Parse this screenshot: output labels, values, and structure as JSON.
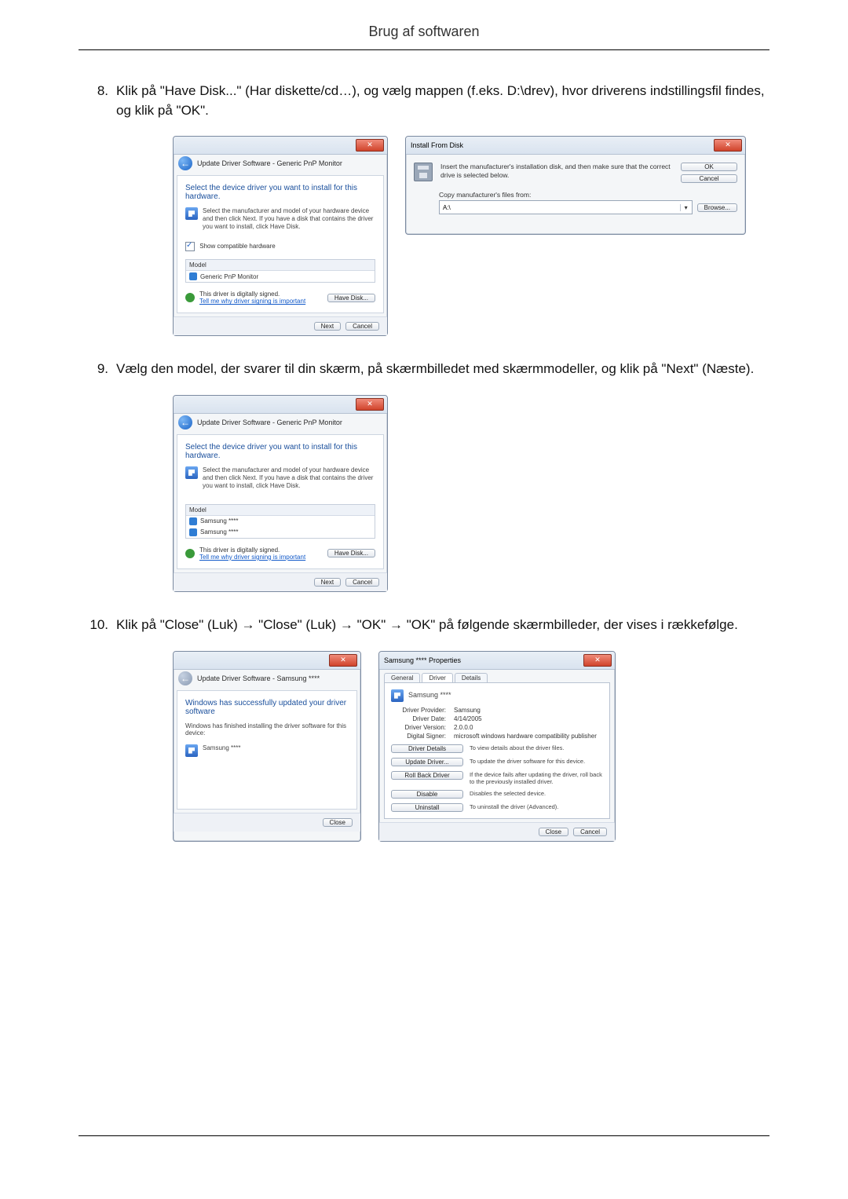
{
  "header": {
    "title": "Brug af softwaren"
  },
  "steps": {
    "s8": {
      "num": "8.",
      "text": "Klik på \"Have Disk...\" (Har diskette/cd…), og vælg mappen (f.eks. D:\\drev), hvor driverens indstillingsfil findes, og klik på \"OK\"."
    },
    "s9": {
      "num": "9.",
      "text": "Vælg den model, der svarer til din skærm, på skærmbilledet med skærmmodeller, og klik på \"Next\" (Næste)."
    },
    "s10": {
      "num": "10.",
      "text": "Klik på \"Close\" (Luk) → \"Close\" (Luk) → \"OK\" → \"OK\" på følgende skærmbilleder, der vises i rækkefølge."
    }
  },
  "shot_a": {
    "breadcrumb": "Update Driver Software - Generic PnP Monitor",
    "heading": "Select the device driver you want to install for this hardware.",
    "subtext": "Select the manufacturer and model of your hardware device and then click Next. If you have a disk that contains the driver you want to install, click Have Disk.",
    "check_label": "Show compatible hardware",
    "list_header": "Model",
    "list_item": "Generic PnP Monitor",
    "signed_text": "This driver is digitally signed.",
    "signed_link": "Tell me why driver signing is important",
    "have_disk": "Have Disk...",
    "next": "Next",
    "cancel": "Cancel"
  },
  "shot_b": {
    "title": "Install From Disk",
    "msg": "Insert the manufacturer's installation disk, and then make sure that the correct drive is selected below.",
    "ok": "OK",
    "cancel": "Cancel",
    "copy_label": "Copy manufacturer's files from:",
    "combo_value": "A:\\",
    "browse": "Browse..."
  },
  "shot_c": {
    "breadcrumb": "Update Driver Software - Generic PnP Monitor",
    "heading": "Select the device driver you want to install for this hardware.",
    "subtext": "Select the manufacturer and model of your hardware device and then click Next. If you have a disk that contains the driver you want to install, click Have Disk.",
    "list_header": "Model",
    "list_item1": "Samsung ****",
    "list_item2": "Samsung ****",
    "signed_text": "This driver is digitally signed.",
    "signed_link": "Tell me why driver signing is important",
    "have_disk": "Have Disk...",
    "next": "Next",
    "cancel": "Cancel"
  },
  "shot_d": {
    "breadcrumb": "Update Driver Software - Samsung ****",
    "heading": "Windows has successfully updated your driver software",
    "subtext": "Windows has finished installing the driver software for this device:",
    "device": "Samsung ****",
    "close": "Close"
  },
  "shot_e": {
    "title": "Samsung **** Properties",
    "tabs": {
      "general": "General",
      "driver": "Driver",
      "details": "Details"
    },
    "device": "Samsung ****",
    "rows": {
      "provider_l": "Driver Provider:",
      "provider_v": "Samsung",
      "date_l": "Driver Date:",
      "date_v": "4/14/2005",
      "version_l": "Driver Version:",
      "version_v": "2.0.0.0",
      "signer_l": "Digital Signer:",
      "signer_v": "microsoft windows hardware compatibility publisher"
    },
    "btns": {
      "details": "Driver Details",
      "details_d": "To view details about the driver files.",
      "update": "Update Driver...",
      "update_d": "To update the driver software for this device.",
      "rollback": "Roll Back Driver",
      "rollback_d": "If the device fails after updating the driver, roll back to the previously installed driver.",
      "disable": "Disable",
      "disable_d": "Disables the selected device.",
      "uninstall": "Uninstall",
      "uninstall_d": "To uninstall the driver (Advanced)."
    },
    "close": "Close",
    "cancel": "Cancel"
  }
}
